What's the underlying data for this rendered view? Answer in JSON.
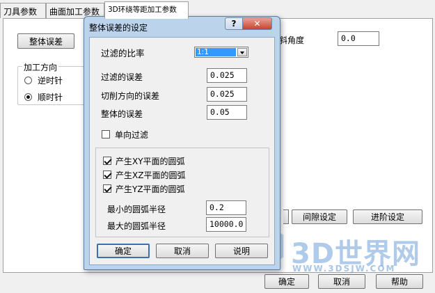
{
  "tabs": [
    "刀具参数",
    "曲面加工参数",
    "3D环绕等距加工参数"
  ],
  "background": {
    "overall_tolerance_button": "整体误差",
    "tilt_angle_label": "斜角度",
    "tilt_angle_value": "0.0",
    "direction_group_title": "加工方向",
    "ccw_label": "逆时针",
    "cw_label": "顺时针",
    "gap_settings_button": "间隙设定",
    "advanced_settings_button": "进阶设定",
    "ok_button": "确定",
    "cancel_button": "取消",
    "help_button": "帮助"
  },
  "dialog": {
    "title": "整体误差的设定",
    "help_glyph": "?",
    "close_glyph": "✕",
    "filter_ratio_label": "过滤的比率",
    "filter_ratio_value": "1:1",
    "filter_tolerance_label": "过滤的误差",
    "filter_tolerance_value": "0.025",
    "cut_direction_tolerance_label": "切削方向的误差",
    "cut_direction_tolerance_value": "0.025",
    "overall_tolerance_label": "整体的误差",
    "overall_tolerance_value": "0.05",
    "one_way_filter_label": "单向过滤",
    "xy_arc_label": "产生XY平面的圆弧",
    "xz_arc_label": "产生XZ平面的圆弧",
    "yz_arc_label": "产生YZ平面的圆弧",
    "min_radius_label": "最小的圆弧半径",
    "min_radius_value": "0.2",
    "max_radius_label": "最大的圆弧半径",
    "max_radius_value": "10000.0",
    "ok_button": "确定",
    "cancel_button": "取消",
    "explain_button": "说明"
  },
  "watermark": {
    "brand": "3D世界网",
    "url": "WWW.3DSJW.COM"
  },
  "colors": {
    "dialog_frame": "#bcd3ec",
    "close_button": "#c7432c",
    "selection": "#3399ff"
  }
}
